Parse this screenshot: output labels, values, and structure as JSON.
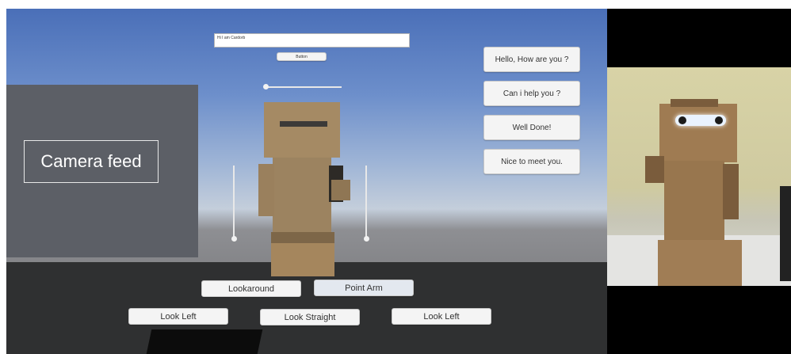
{
  "scene": {
    "text_field_value": "Hi I am Cardorb",
    "top_button_label": "Button",
    "camera_label": "Camera feed",
    "phrases": [
      "Hello, How are you ?",
      "Can i help you ?",
      "Well Done!",
      "Nice to meet you."
    ],
    "actions_row1": [
      "Lookaround",
      "Point Arm"
    ],
    "actions_row2": [
      "Look Left",
      "Look Straight",
      "Look Left"
    ]
  },
  "colors": {
    "sky_top": "#4a6fb8",
    "ground": "#2f3031",
    "cardboard": "#a58a64"
  }
}
